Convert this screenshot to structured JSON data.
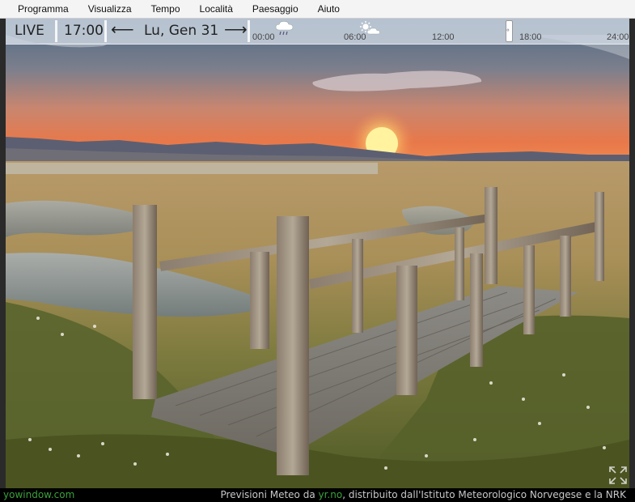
{
  "menu": {
    "items": [
      "Programma",
      "Visualizza",
      "Tempo",
      "Località",
      "Paesaggio",
      "Aiuto"
    ]
  },
  "toolbar": {
    "live_label": "LIVE",
    "time": "17:00",
    "date": "Lu, Gen 31",
    "prev_icon": "arrow-left-icon",
    "next_icon": "arrow-right-icon"
  },
  "timeline": {
    "ticks": [
      "00:00",
      "06:00",
      "12:00",
      "18:00",
      "24:00"
    ],
    "icons": [
      "rain-cloud-icon",
      "sun-cloud-icon"
    ],
    "handle_time": "17:00"
  },
  "footer": {
    "brand": "yowindow.com",
    "credit_prefix": "Previsioni Meteo da ",
    "credit_link": "yr.no",
    "credit_suffix": ", distribuito dall'Istituto Meteorologico Norvegese e la NRK"
  },
  "colors": {
    "accent_green": "#3ca03c",
    "toolbar_bg": "#cdd6e0",
    "sky_top": "#4e6a86",
    "sky_horizon": "#e8784a"
  }
}
